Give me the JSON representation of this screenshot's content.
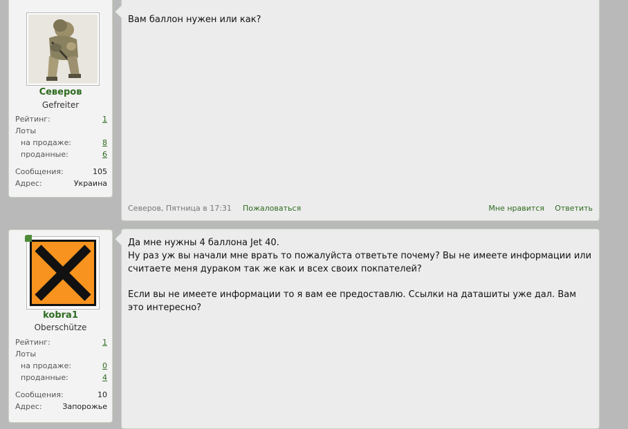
{
  "colors": {
    "background": "#b9b9b9",
    "panel": "#f3f3f3",
    "post": "#ececec",
    "accent": "#2d6b1f"
  },
  "posts": [
    {
      "user": {
        "name": "Северов",
        "title": "Gefreiter",
        "stats": {
          "rating_label": "Рейтинг:",
          "rating": "1",
          "lots_label": "Лоты",
          "on_sale_label": "на продаже:",
          "on_sale": "8",
          "sold_label": "проданные:",
          "sold": "6",
          "messages_label": "Сообщения:",
          "messages": "105",
          "address_label": "Адрес:",
          "address": "Украина"
        }
      },
      "message": {
        "line1": "Вам баллон нужен или как?"
      },
      "footer": {
        "meta": "Северов, Пятница в 17:31",
        "report": "Пожаловаться",
        "like": "Мне нравится",
        "reply": "Ответить"
      }
    },
    {
      "user": {
        "name": "kobra1",
        "title": "Oberschütze",
        "online_icon": "online-indicator",
        "stats": {
          "rating_label": "Рейтинг:",
          "rating": "1",
          "lots_label": "Лоты",
          "on_sale_label": "на продаже:",
          "on_sale": "0",
          "sold_label": "проданные:",
          "sold": "4",
          "messages_label": "Сообщения:",
          "messages": "10",
          "address_label": "Адрес:",
          "address": "Запорожье"
        }
      },
      "message": {
        "line1": "Да мне нужны 4 баллона Jet 40.",
        "line2": "Ну раз уж вы начали мне врать то пожалуйста ответьте почему? Вы не имеете информации или считаете меня дураком так же как и всех своих покпателей?",
        "line3": "Если вы не имеете информации то я вам ее предоставлю. Ссылки на даташиты уже дал. Вам это интересно?"
      }
    }
  ]
}
